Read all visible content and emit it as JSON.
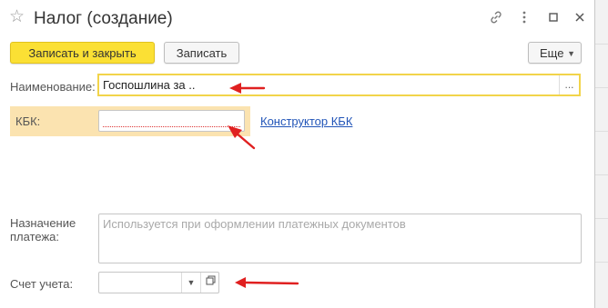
{
  "window": {
    "title": "Налог (создание)",
    "icons": {
      "favorite": "star-icon",
      "link": "link-icon",
      "menu": "kebab-menu-icon",
      "maximize": "maximize-icon",
      "close": "close-icon"
    }
  },
  "toolbar": {
    "save_close_label": "Записать и закрыть",
    "save_label": "Записать",
    "more_label": "Еще"
  },
  "form": {
    "name_label": "Наименование:",
    "name_value": "Госпошлина за ..",
    "name_select_button": "...",
    "kbk_label": "КБК:",
    "kbk_value": "",
    "kbk_link": "Конструктор КБК",
    "purpose_label_line1": "Назначение",
    "purpose_label_line2": "платежа:",
    "purpose_placeholder": "Используется при оформлении платежных документов",
    "account_label": "Счет учета:",
    "account_value": ""
  },
  "colors": {
    "primary_button": "#fbe034",
    "highlight_band": "#fbe3b0",
    "focus_border": "#f2d44a",
    "link": "#2255b8",
    "annotation_arrow": "#e02020"
  }
}
